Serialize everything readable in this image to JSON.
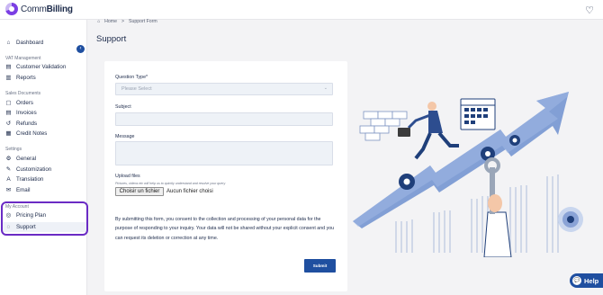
{
  "app": {
    "brand_part1": "Comm",
    "brand_part2": "Billing",
    "accent_color": "#1f4fa0",
    "brand_color": "#7b3fe4",
    "highlight_color": "#6a2bc4"
  },
  "header": {
    "heart_icon": "heart-outline-icon"
  },
  "sidebar": {
    "dashboard": "Dashboard",
    "sections": {
      "vat": "VAT Management",
      "sales": "Sales Documents",
      "settings": "Settings",
      "account": "My Account"
    },
    "vat_items": [
      "Customer Validation",
      "Reports"
    ],
    "sales_items": [
      "Orders",
      "Invoices",
      "Refunds",
      "Credit Notes"
    ],
    "settings_items": [
      "General",
      "Customization",
      "Translation",
      "Email"
    ],
    "account_items": [
      "Pricing Plan",
      "Support"
    ],
    "active_item": "Support"
  },
  "breadcrumb": {
    "home": "Home",
    "separator": ">",
    "current": "Support Form"
  },
  "page": {
    "title": "Support"
  },
  "form": {
    "question_type_label": "Question Type*",
    "question_type_placeholder": "Please Select",
    "subject_label": "Subject",
    "subject_value": "",
    "message_label": "Message",
    "message_value": "",
    "upload_label": "Upload files",
    "upload_hint": "Pictures, videos etc will help us to quickly understand and resolve your query",
    "file_button": "Choisir un fichier",
    "file_status": "Aucun fichier choisi",
    "consent_text": "By submitting this form, you consent to the collection and processing of your personal data for the purpose of responding to your inquiry. Your data will not be shared without your explicit consent and you can request its deletion or correction at any time.",
    "submit_label": "Submit"
  },
  "help": {
    "label": "Help"
  }
}
